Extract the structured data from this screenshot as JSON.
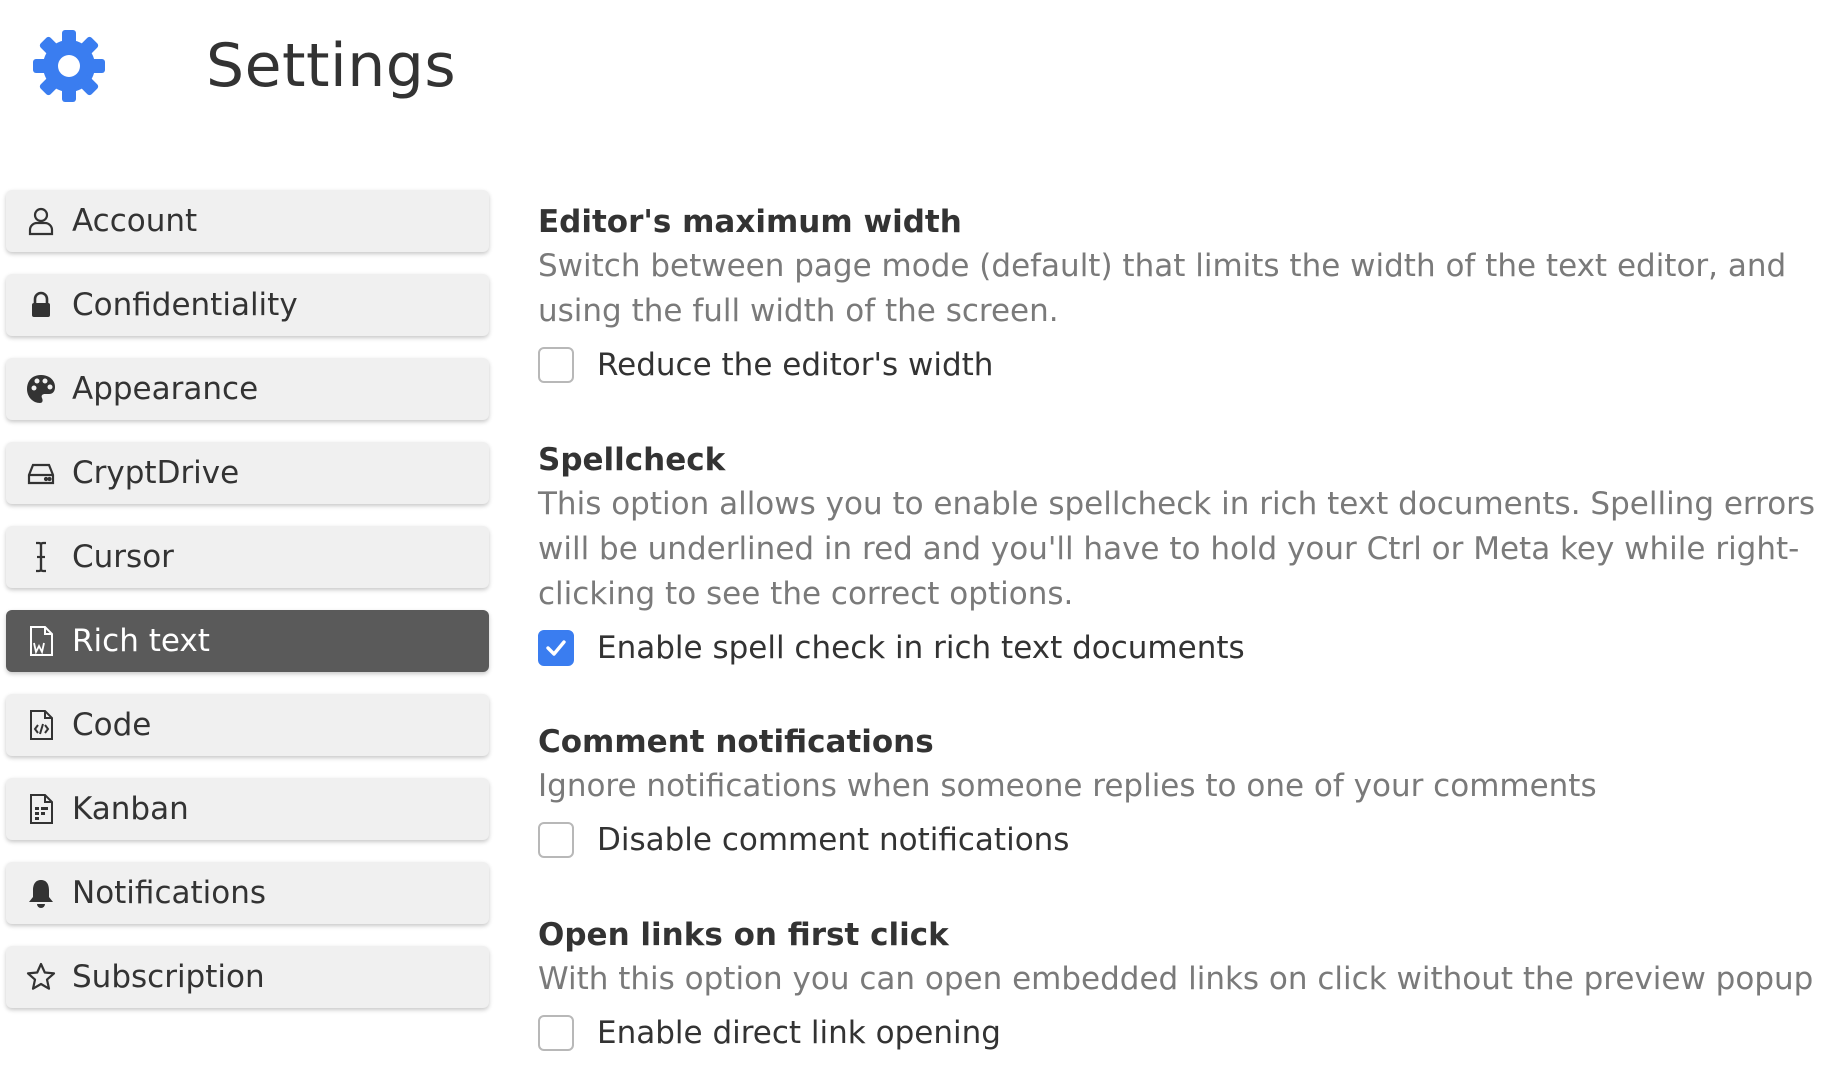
{
  "header": {
    "title": "Settings",
    "icon": "gear-icon",
    "icon_color": "#3a7df0"
  },
  "sidebar": {
    "items": [
      {
        "label": "Account",
        "icon": "user-icon",
        "active": false
      },
      {
        "label": "Confidentiality",
        "icon": "lock-icon",
        "active": false
      },
      {
        "label": "Appearance",
        "icon": "palette-icon",
        "active": false
      },
      {
        "label": "CryptDrive",
        "icon": "drive-icon",
        "active": false
      },
      {
        "label": "Cursor",
        "icon": "text-cursor-icon",
        "active": false
      },
      {
        "label": "Rich text",
        "icon": "rich-text-document-icon",
        "active": true
      },
      {
        "label": "Code",
        "icon": "code-document-icon",
        "active": false
      },
      {
        "label": "Kanban",
        "icon": "kanban-document-icon",
        "active": false
      },
      {
        "label": "Notifications",
        "icon": "bell-icon",
        "active": false
      },
      {
        "label": "Subscription",
        "icon": "star-icon",
        "active": false
      }
    ],
    "active_bg": "#5a5a5a",
    "item_bg": "#f0f0f0"
  },
  "sections": [
    {
      "title": "Editor's maximum width",
      "description": "Switch between page mode (default) that limits the width of the text editor, and using the full width of the screen.",
      "checkbox_label": "Reduce the editor's width",
      "checked": false
    },
    {
      "title": "Spellcheck",
      "description": "This option allows you to enable spellcheck in rich text documents. Spelling errors will be underlined in red and you'll have to hold your Ctrl or Meta key while right-clicking to see the correct options.",
      "checkbox_label": "Enable spell check in rich text documents",
      "checked": true
    },
    {
      "title": "Comment notifications",
      "description": "Ignore notifications when someone replies to one of your comments",
      "checkbox_label": "Disable comment notifications",
      "checked": false
    },
    {
      "title": "Open links on first click",
      "description": "With this option you can open embedded links on click without the preview popup",
      "checkbox_label": "Enable direct link opening",
      "checked": false
    }
  ],
  "colors": {
    "accent": "#3a7df0",
    "description_text": "#7a7a7a"
  }
}
